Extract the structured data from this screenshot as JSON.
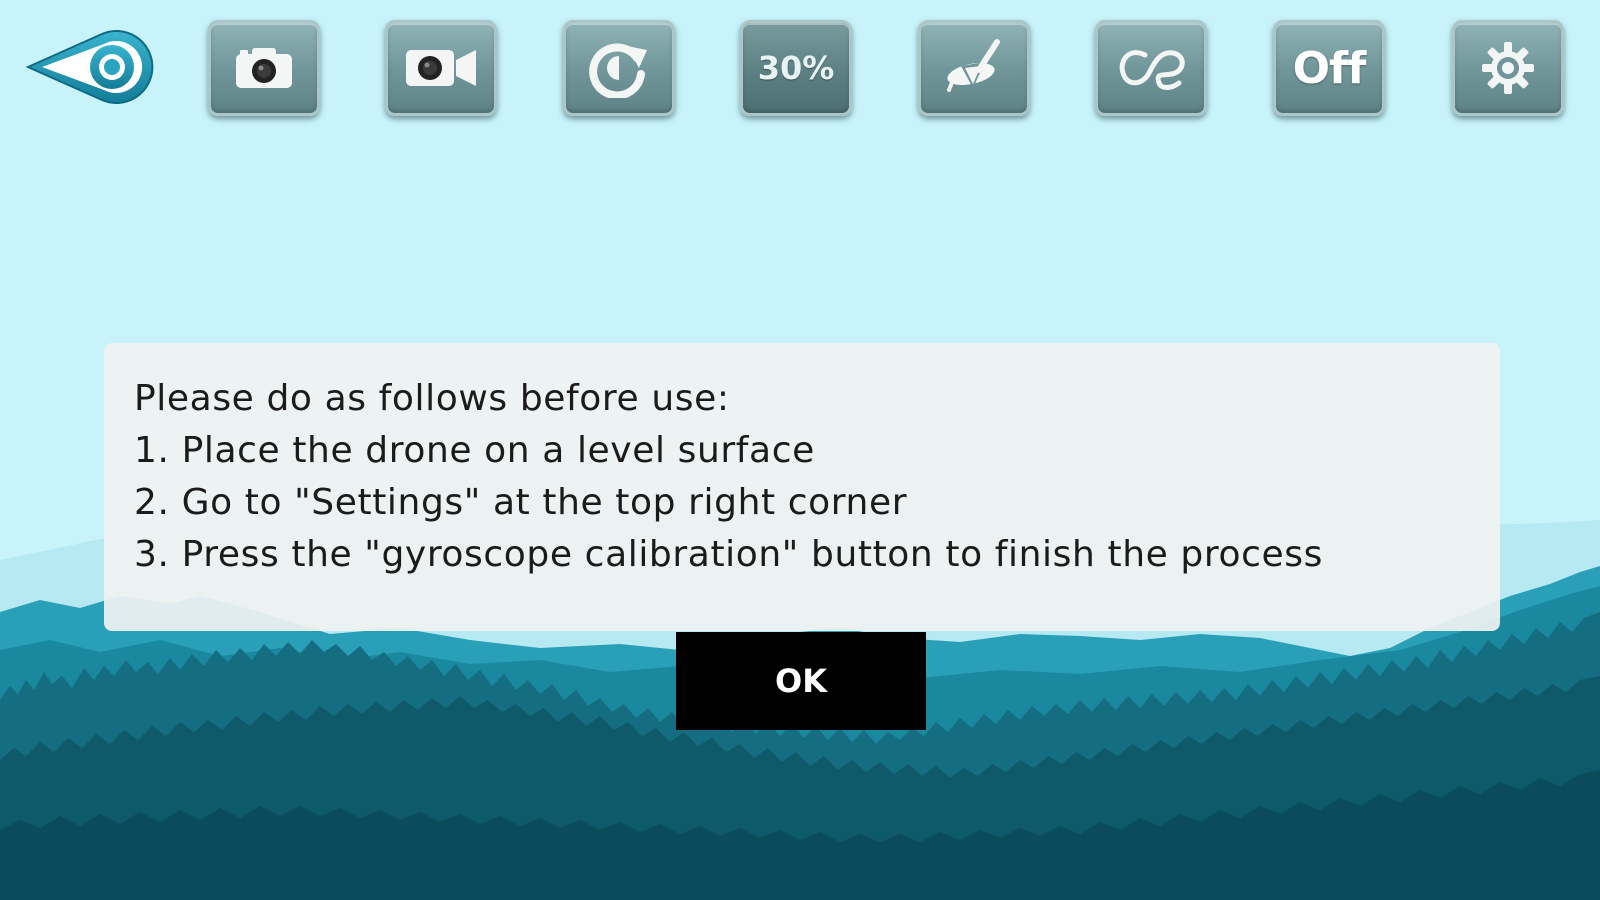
{
  "toolbar": {
    "back_icon": "back-eye-icon",
    "photo_icon": "camera-icon",
    "video_icon": "video-camera-icon",
    "rotate_icon": "rotate-icon",
    "speed_label": "30%",
    "headless_icon": "headless-mode-icon",
    "trajectory_icon": "trajectory-flight-icon",
    "vr_label": "Off",
    "settings_icon": "gear-icon"
  },
  "dialog": {
    "lines": [
      "Please do as follows before use:",
      "1. Place the drone on a level surface",
      "2. Go to \"Settings\" at the top right corner",
      "3. Press the \"gyroscope calibration\" button to finish the process"
    ],
    "ok_label": "OK"
  },
  "colors": {
    "sky": "#c8f3fb",
    "mountain_far": "#2a9db5",
    "mountain_mid": "#187f95",
    "forest_dark": "#0d5566",
    "button_face": "#6f9599",
    "dialog_bg": "#f0f2f2",
    "ok_bg": "#000000"
  }
}
